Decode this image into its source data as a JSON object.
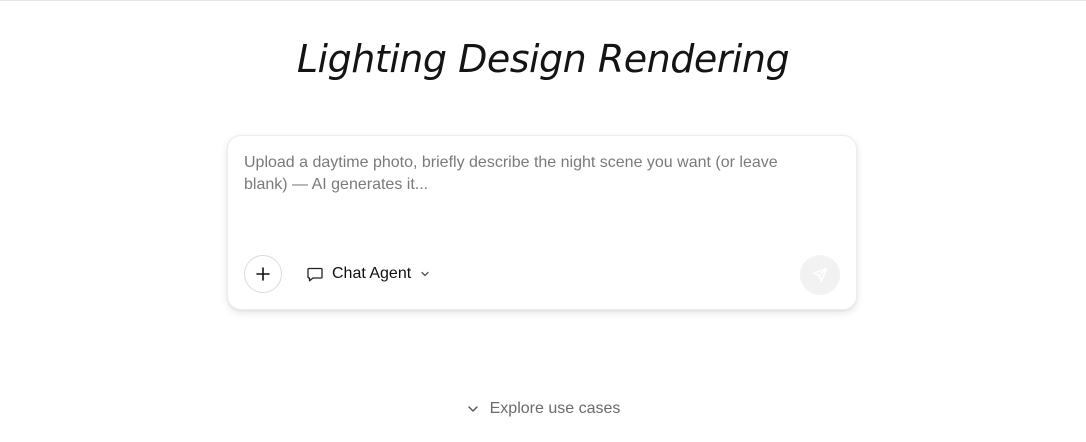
{
  "header": {
    "title": "Lighting Design Rendering"
  },
  "composer": {
    "placeholder": "Upload a daytime photo, briefly describe the night scene you want (or leave blank) — AI generates it...",
    "agent_label": "Chat Agent",
    "icons": {
      "add": "plus-icon",
      "agent": "chat-bubble-icon",
      "dropdown": "chevron-down-icon",
      "send": "send-icon"
    }
  },
  "footer": {
    "explore_label": "Explore use cases",
    "icon": "chevron-down-icon"
  },
  "colors": {
    "send_button_bg": "#f2f2f2",
    "muted_text": "#7a7a7a"
  }
}
